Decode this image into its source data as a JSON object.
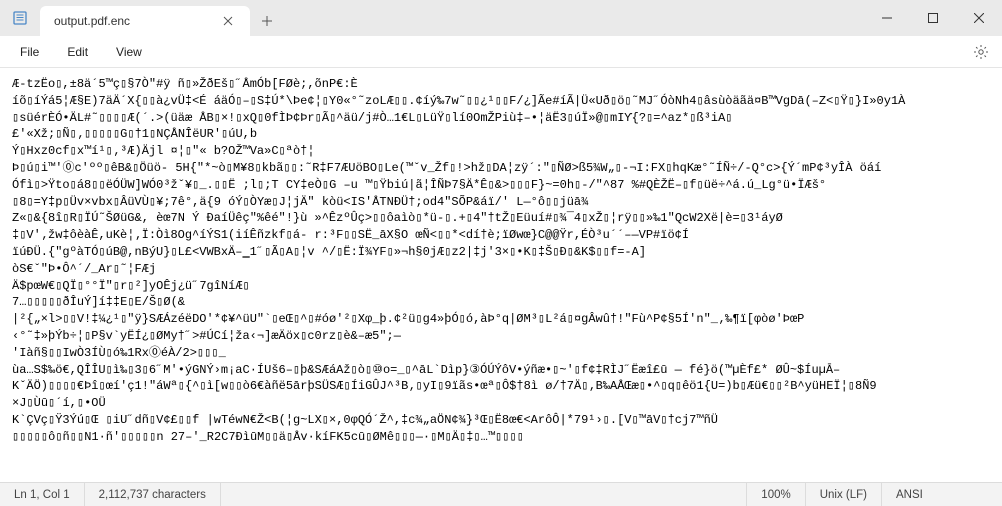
{
  "tab": {
    "title": "output.pdf.enc"
  },
  "menu": {
    "file": "File",
    "edit": "Edit",
    "view": "View"
  },
  "content": {
    "lines": [
      "Æ-tzËo▯,±8ä´5™ç▯§7Ò\"#ÿ ñ▯»ŽðEš▯˝ÅmÓb[FØè;,õnP€:È",
      "íõ▯íÝá5¦Æ§E)7äÄ´X{▯▯à¿vÜ‡<É áäÓ▯–▯S‡Ú*\\Þe¢¦▯Y0«°˜zoLÆ▯▯.¢íý‰7w˜▯▯¿¹▯▯F/¿]Ãe#íÃ|Ü«Uð▯ö▯˜MJ˝ÓòNh4▯âsùòäãä¤B™VgDā(–Z<▯Ÿ▯}I»0y1À",
      "▯süérÈÓ•ÄL#˜▯▯▯▯Æ(´.>(üäæ ÅB▯×!▯xQ▯0fÌÞ¢Þr▯Ã▯^äü/j#Ò…1€L▯LüŸ▯lí0OmŽPiù‡–•¦äË3▯úÏ»@▯mIƳ{?▯=^az*▯ß³iA▯",
      "£'«Xž;▯Ñ▯‚▯▯▯▯▯G▯†1▯NÇÅNÎëUR'▯úU,b",
      "Ý▯Hxz0cf▯x™í¹▯‚³Æ)Äjl ¤¦▯\"« b?OŽ™Va»C▯ªò†¦",
      "Þ▯ú▯i™'⓪c'ºº▯êB&▯Öüö- 5H{\"*~ò▯M¥8▯kbã▯▯:˜R‡F7ÆUöBO▯Le(™ˇv_Žf▯!>hž▯DA¦zÿ´:\"▯ÑØ>ß5¾W„▯-¬I:FX▯hqKæ°˜ÍÑ÷/-Q°c>{Ý´mP¢³yÎÀ öáí",
      " Ófì▯>Ÿto▯á8▯▯ëÓÜW]WÓ0³žˇ¥▯_.▯▯Ë ;l▯;T CY‡eÒ▯G –u ™▯Ÿbiú|ã¦ÎÑÞ7§Ä*Ê▯&>▯▯▯F}~=0h▯-/\"^87 %#QÈŽË–▯f▯üë÷^á.ú_Lg°ü•ÏÆš°",
      "▯8▯=Y‡p▯Üv×vbx▯ÂüVÙ▯¥;7ê°,ä{9 óÝ▯ÒΥæ▯J¦jÄ\" kòü<IS'ÅTNÐÜ†;od4\"SÕP&áï/'   L—°ô▯▯jüā¾",
      "Z«▯&{8î▯R▯ÏÚ˜ŠØüG&, èœ7N     Ý ÐaíÜêç\"%êé\"!}ù »^ÊzºÛç>▯▯ôaìò▯*ü-▯.+▯4\"†tŽ▯Eüuí#▯¾¯4▯xŽ▯¦rÿ▯▯»‰1\"QcW2Xë|è=▯3¹áyØ",
      "‡▯V'‚žw‡ôèàÊ,uKè¦‚Ï:Òì8Og^íÝS1(iíÊñzkf▯á- r:³F▯▯SË_āX§O œÑ<▯▯*<dí†è;ïØwœ}C@@Ϋr,ÉÒ³u´´–—VP#ïö¢Í",
      "ïúÐÜ.{\"gºàTÓ▯úB@,nBýU}▯L£<VWBxÄ–‗1˝▯Ã▯A▯¦v ^/▯Ë:Ï¾YF▯»¬h§0jÆ▯z2|‡j'3×▯•K▯‡Š▯Đ▯&K$▯▯f=-A]",
      "òS€ˇ\"Þ•Ô^´/_Ar▯˜¦FÆj",
      "Ä$pœW€▯QÏ▯°°Ï″▯r▯²]yOÊj¿ü˝7gîNíÆ▯",
      "7…▯▯▯▯▯ðÎuÝ]í‡‡E▯E/Š▯Ø(&",
      "|²{„×l>▯▯V!‡¼¿¹▯\"ÿ}SÆÁzéëDO'*¢¥^üU\"`▯eŒ▯^▯#óø'²▯Xφ_þ.¢²ü▯g4»þÓ▯ó,àÞ°q|ØM³▯L²á▯¤gÂwû†!\"Fù^P¢§5Í'n\"_‚‰¶ï[φòø'ÞœP",
      "‹°˜‡»þÝb÷¦▯P§v`yËÍ¿▯ØMy†˝>#ÚCí¦ža‹¬]æÄöx▯c0rz▯è&–æ5\";—",
      "'Iàñ§▯▯IwÒ3ÍÙ▯ó‰1Rx⓪éÀ/2>▯▯▯_",
      "ùa…S$‰ö€,QÎÎU▯ì‰▯3▯6˝M'•ýGNÝ›m¡aC·ÍUš6–▯þ&SÆáAž▯ò▯⑩o=_▯^āL`Dìp}③ÓÚÝôV•ýñæ•▯~'▯f¢‡RÌJ˝Ëæî£ū — fé}ö(™µÈf£*       ØÛ~$ÍuµĀ–",
      "KˇÄÖ)▯▯▯▯€Þî▯œí'ç1!\"áWª▯{^▯ì[w▯▯ò6€àñë5ārþSÜSÆ▯ÍiGÛJ^³B‚▯yI▯9ïãs•œª▯Ô$†8ì ø/†7Ä▯‚B‰AÅŒæ▯•^▯q▯êö1{U=)b▯Æü€▯▯²B^yüHEÏ¦▯8Ñ9",
      "×J▯Ùū▯´í,▯•OÜ",
      "K`ÇVç▯Ϋ3Ýú▯Œ ▯iU˝dñ▯V¢£▯▯f  |wTéwN€Ž<B(¦g~LX▯×,0φQÓ´Ž^,‡c¾„aÖN¢¾}³Œ▯Ë8œ€<ArôÔ|*79¹›▯.[V▯™āV▯†cj7™ñÜ",
      "▯▯▯▯▯ô▯ñ▯▯N1·ñ'▯▯▯▯▯n 27–'_R2C7ÐìūM▯▯ä▯Åv·kíFK5cū▯ØMê▯▯▯—·▯M▯Ä▯‡▯…™▯▯▯▯"
    ]
  },
  "status": {
    "position": "Ln 1, Col 1",
    "chars": "2,112,737 characters",
    "zoom": "100%",
    "eol": "Unix (LF)",
    "encoding": "ANSI"
  }
}
